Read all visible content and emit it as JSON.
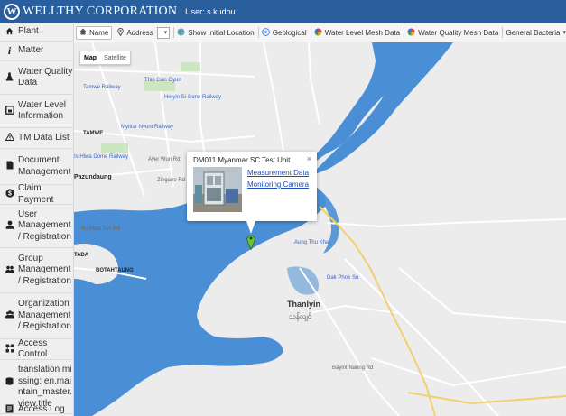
{
  "header": {
    "logo_mark": "W",
    "logo_text": "WELLTHY CORPORATION",
    "user_label": "User: s.kudou",
    "colors": {
      "header_bg": "#2a5f9e"
    }
  },
  "sidebar": {
    "items": [
      {
        "icon": "home-icon",
        "label": "Plant"
      },
      {
        "icon": "info-icon",
        "label": "Matter"
      },
      {
        "icon": "flask-icon",
        "label": "Water Quality Data"
      },
      {
        "icon": "gauge-icon",
        "label": "Water Level Information"
      },
      {
        "icon": "warning-icon",
        "label": "TM Data List"
      },
      {
        "icon": "document-icon",
        "label": "Document Management"
      },
      {
        "icon": "dollar-icon",
        "label": "Claim Payment"
      },
      {
        "icon": "user-icon",
        "label": "User Management / Registration"
      },
      {
        "icon": "group-icon",
        "label": "Group Management / Registration"
      },
      {
        "icon": "organization-icon",
        "label": "Organization Management / Registration"
      },
      {
        "icon": "access-control-icon",
        "label": "Access Control"
      },
      {
        "icon": "database-icon",
        "label": "translation missing: en.maintain_master.view.title"
      },
      {
        "icon": "log-icon",
        "label": "Access Log"
      }
    ]
  },
  "toolbar": {
    "name_button": "Name",
    "address_label": "Address",
    "address_value": "",
    "show_initial_location": "Show Initial Location",
    "geological": "Geological",
    "water_level_mesh": "Water Level Mesh Data",
    "water_quality_mesh": "Water Quality Mesh Data",
    "general_bacteria": "General Bacteria"
  },
  "map": {
    "map_type": {
      "map": "Map",
      "satellite": "Satellite"
    },
    "infowindow": {
      "title": "DM011 Myanmar SC Test Unit",
      "close": "×",
      "link_measurement": "Measurement Data",
      "link_camera": "Monitoring Camera"
    },
    "places": {
      "thanlyin": "Thanlyin",
      "thanlyin_local": "သန်လျင်",
      "pazundaung": "Pazundaung",
      "botahtaung": "BOTAHTAUNG",
      "tamwe": "TAMWE",
      "tada": "TADA",
      "thin_gan_gyun": "Thin Gan Gyun",
      "hmyin_si_gone": "Hmyin Si Gone Railway",
      "tamwe_railway": "Tamwe Railway",
      "myittar_nyunt": "Myittar Nyunt Railway",
      "hlawa_dome": "Is Hlwa Dome Railway",
      "aung_thu_kha": "Aung Thu Kha",
      "dak_phoe_su": "Dak Phoe Su",
      "ayer_wun": "Ayer Wun Rd",
      "zingane": "Zingane Rd",
      "bo_myat_tun": "Bo Myat Tun Rd",
      "bayint_naung": "Bayint Naung Rd"
    },
    "colors": {
      "water": "#4a8fd6",
      "land": "#ececec",
      "road": "#ffffff"
    }
  }
}
